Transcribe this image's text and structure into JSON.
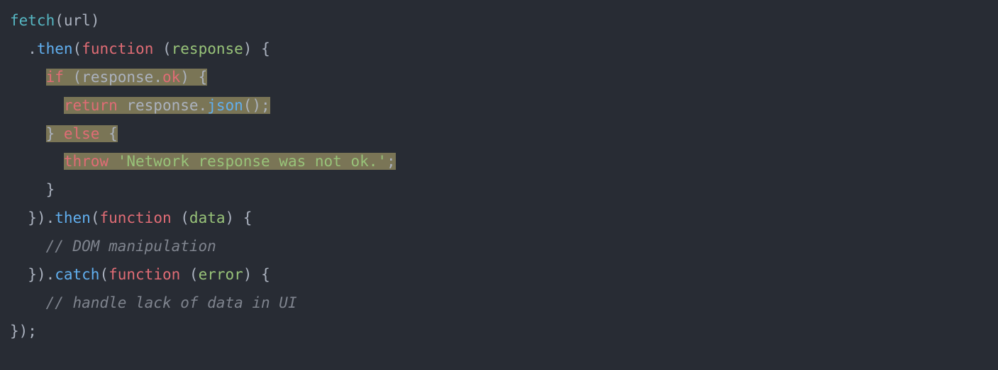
{
  "code": {
    "l1": {
      "t1": "fetch",
      "t2": "(",
      "t3": "url",
      "t4": ")"
    },
    "l2": {
      "indent": "  ",
      "t1": ".",
      "t2": "then",
      "t3": "(",
      "t4": "function",
      "t5": " (",
      "t6": "response",
      "t7": ") {"
    },
    "l3": {
      "indent": "    ",
      "t1": "if",
      "t2": " (",
      "t3": "response",
      "t4": ".",
      "t5": "ok",
      "t6": ") {"
    },
    "l4": {
      "indent": "      ",
      "t1": "return",
      "t2": " ",
      "t3": "response",
      "t4": ".",
      "t5": "json",
      "t6": "();"
    },
    "l5": {
      "indent": "    ",
      "t1": "} ",
      "t2": "else",
      "t3": " {"
    },
    "l6": {
      "indent": "      ",
      "t1": "throw",
      "t2": " ",
      "t3": "'Network response was not ok.'",
      "t4": ";"
    },
    "l7": {
      "indent": "    ",
      "t1": "}"
    },
    "l8": {
      "indent": "  ",
      "t1": "}).",
      "t2": "then",
      "t3": "(",
      "t4": "function",
      "t5": " (",
      "t6": "data",
      "t7": ") {"
    },
    "l9": {
      "indent": "    ",
      "t1": "// DOM manipulation"
    },
    "l10": {
      "indent": "  ",
      "t1": "}).",
      "t2": "catch",
      "t3": "(",
      "t4": "function",
      "t5": " (",
      "t6": "error",
      "t7": ") {"
    },
    "l11": {
      "indent": "    ",
      "t1": "// handle lack of data in UI"
    },
    "l12": {
      "t1": "});"
    }
  }
}
